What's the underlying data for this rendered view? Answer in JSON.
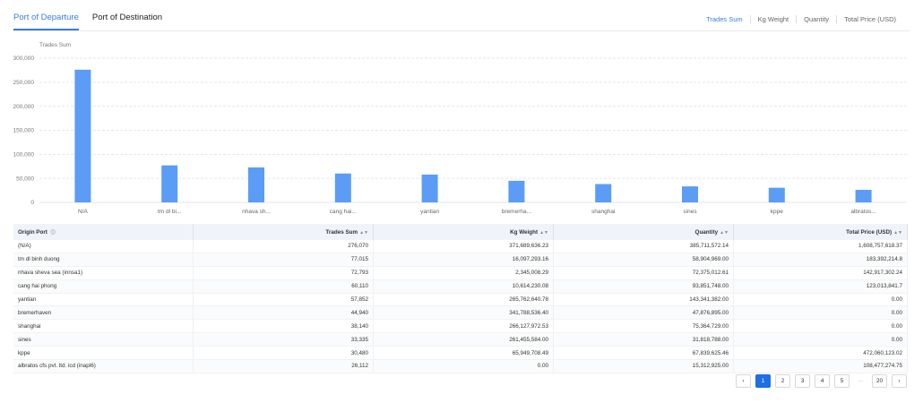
{
  "tabs": [
    "Port of Departure",
    "Port of Destination"
  ],
  "metrics": [
    "Trades Sum",
    "Kg Weight",
    "Quantity",
    "Total Price (USD)"
  ],
  "table": {
    "headers": [
      "Origin Port",
      "Trades Sum",
      "Kg Weight",
      "Quantity",
      "Total Price (USD)"
    ],
    "rows": [
      [
        "(N/A)",
        "276,070",
        "371,689,636.23",
        "385,711,572.14",
        "1,608,757,618.37"
      ],
      [
        "tm dl binh duong",
        "77,015",
        "16,097,293.16",
        "58,904,969.00",
        "183,392,214.8"
      ],
      [
        "nhava sheva sea (innsa1)",
        "72,793",
        "2,345,008.29",
        "72,375,012.61",
        "142,917,302.24"
      ],
      [
        "cang hai phong",
        "60,110",
        "10,614,230.08",
        "93,851,748.00",
        "123,013,841.7"
      ],
      [
        "yantian",
        "57,852",
        "265,762,640.78",
        "143,341,382.00",
        "0.00"
      ],
      [
        "bremerhaven",
        "44,940",
        "341,788,536.40",
        "47,876,895.00",
        "0.00"
      ],
      [
        "shanghai",
        "38,140",
        "266,127,972.53",
        "75,364,729.00",
        "0.00"
      ],
      [
        "sines",
        "33,335",
        "261,455,584.00",
        "31,818,788.00",
        "0.00"
      ],
      [
        "kppe",
        "30,480",
        "65,949,708.49",
        "67,839,625.46",
        "472,060,123.02"
      ],
      [
        "albratos cfs pvt. ltd. icd (inapl6)",
        "26,112",
        "0.00",
        "15,312,925.00",
        "108,477,274.75"
      ]
    ]
  },
  "pagination": {
    "pages": [
      "1",
      "2",
      "3",
      "4",
      "5"
    ],
    "ellipsis": "···",
    "last": "20",
    "prev_icon": "chevron-left-icon",
    "next_icon": "chevron-right-icon"
  },
  "colors": {
    "accent": "#3b7ddd",
    "bar": "#5b9cf6",
    "header_bg": "#f0f3fa"
  },
  "chart_data": {
    "type": "bar",
    "ylabel": "Trades Sum",
    "categories": [
      "N/A",
      "tm dl bi...",
      "nhava sh...",
      "cang hai...",
      "yantian",
      "bremerha...",
      "shanghai",
      "sines",
      "kppe",
      "albratos..."
    ],
    "values": [
      276070,
      77015,
      72793,
      60110,
      57852,
      44940,
      38140,
      33335,
      30480,
      26112
    ],
    "ylim": [
      0,
      300000
    ],
    "yticks": [
      "0",
      "50,000",
      "100,000",
      "150,000",
      "200,000",
      "250,000",
      "300,000"
    ],
    "grid": true
  }
}
